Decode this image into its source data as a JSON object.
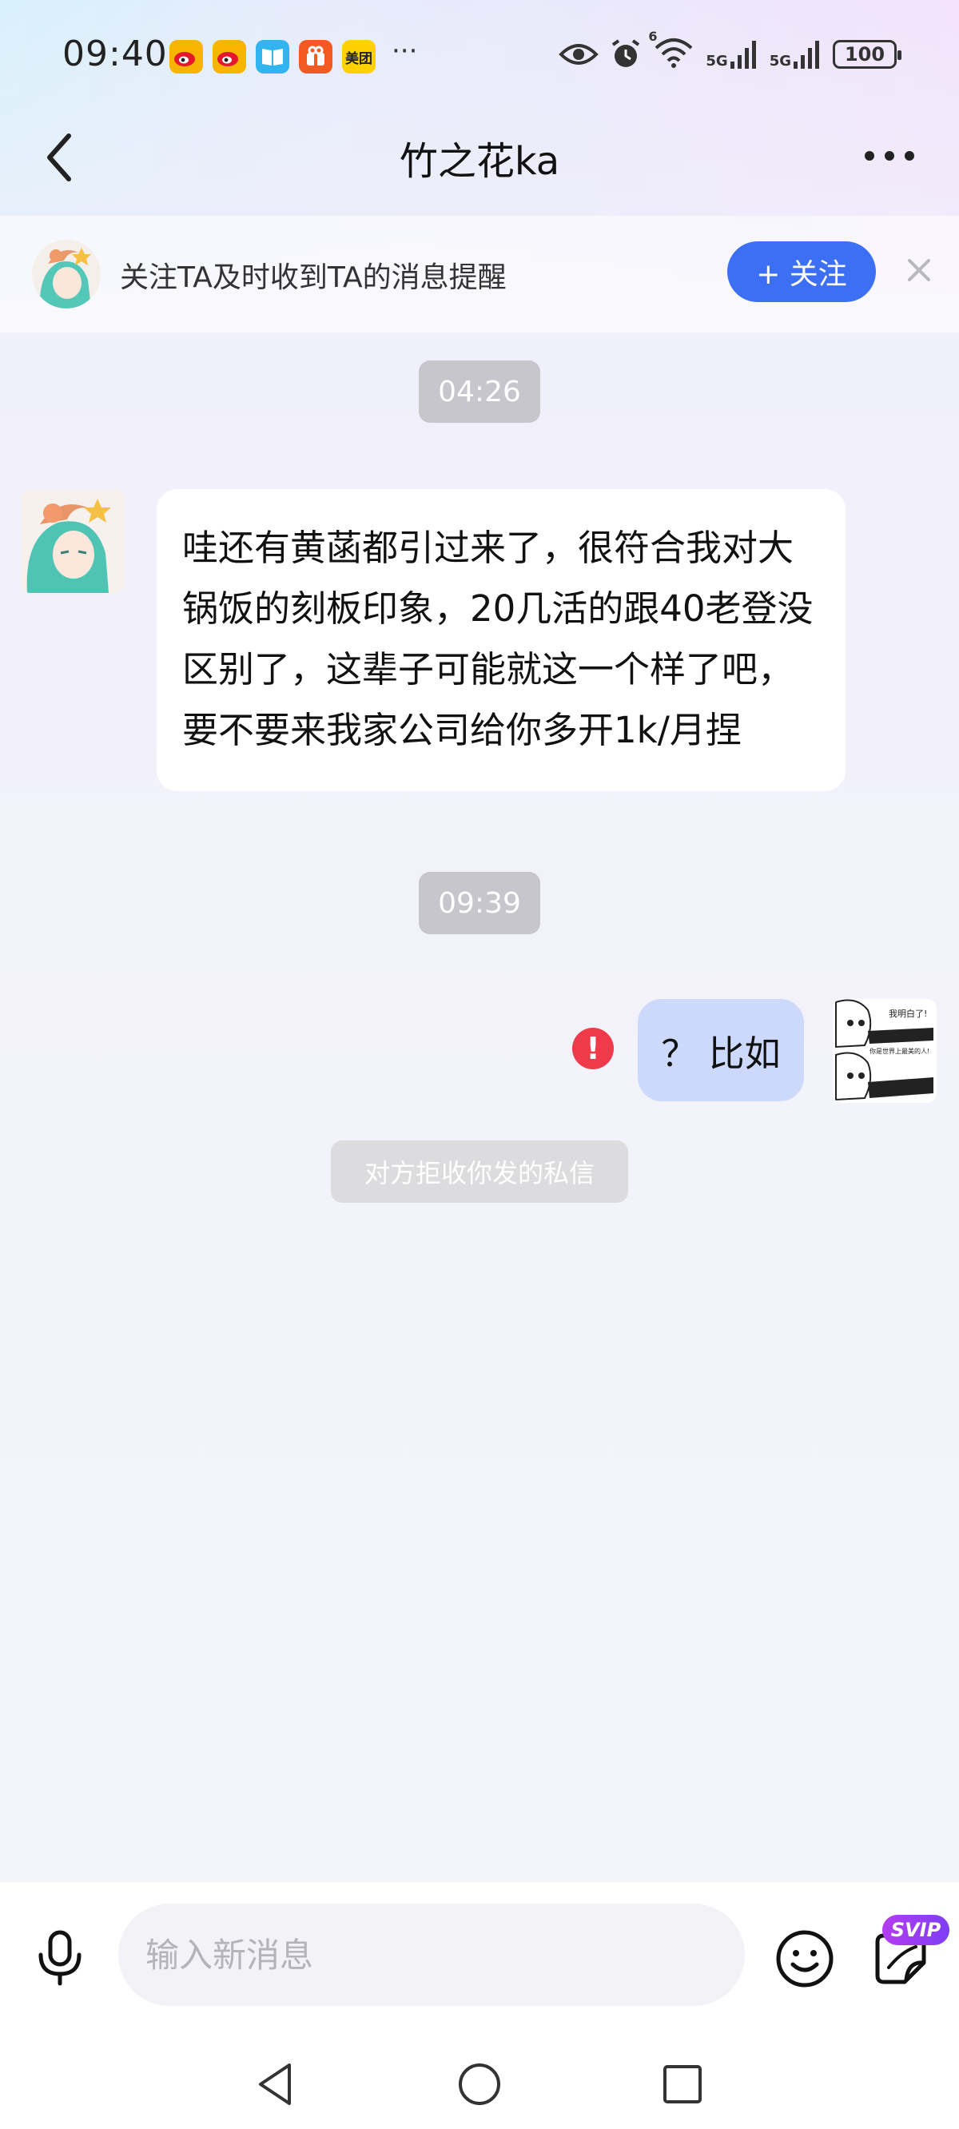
{
  "status_bar": {
    "time": "09:40",
    "app_icons": [
      "weibo-icon",
      "weibo-icon",
      "book-icon",
      "gift-icon",
      "meituan-icon"
    ],
    "meituan_label": "美团",
    "more": "···",
    "battery": "100",
    "network_1": "5G",
    "network_2": "5G",
    "wifi_label": "6"
  },
  "header": {
    "title": "竹之花ka"
  },
  "follow_banner": {
    "text": "关注TA及时收到TA的消息提醒",
    "button_label": "+ 关注"
  },
  "messages": {
    "timestamp_1": "04:26",
    "incoming_text": "哇还有黄菡都引过来了，很符合我对大锅饭的刻板印象，20几活的跟40老登没区别了，这辈子可能就这一个样了吧，要不要来我家公司给你多开1k/月捏",
    "timestamp_2": "09:39",
    "outgoing_text": "？ 比如",
    "error_icon": "!",
    "system_notice": "对方拒收你发的私信",
    "sticker_caption_1": "我明白了!",
    "sticker_caption_2": "你是世界上最美的人!"
  },
  "input_bar": {
    "placeholder": "输入新消息",
    "svip_badge": "SVIP"
  },
  "colors": {
    "accent_blue": "#3d6ff5",
    "outgoing_bubble": "#cdd9fb",
    "error_red": "#ee3a4a",
    "timestamp_bg": "#c6c6cc",
    "svip_purple": "#9a3ef2"
  }
}
